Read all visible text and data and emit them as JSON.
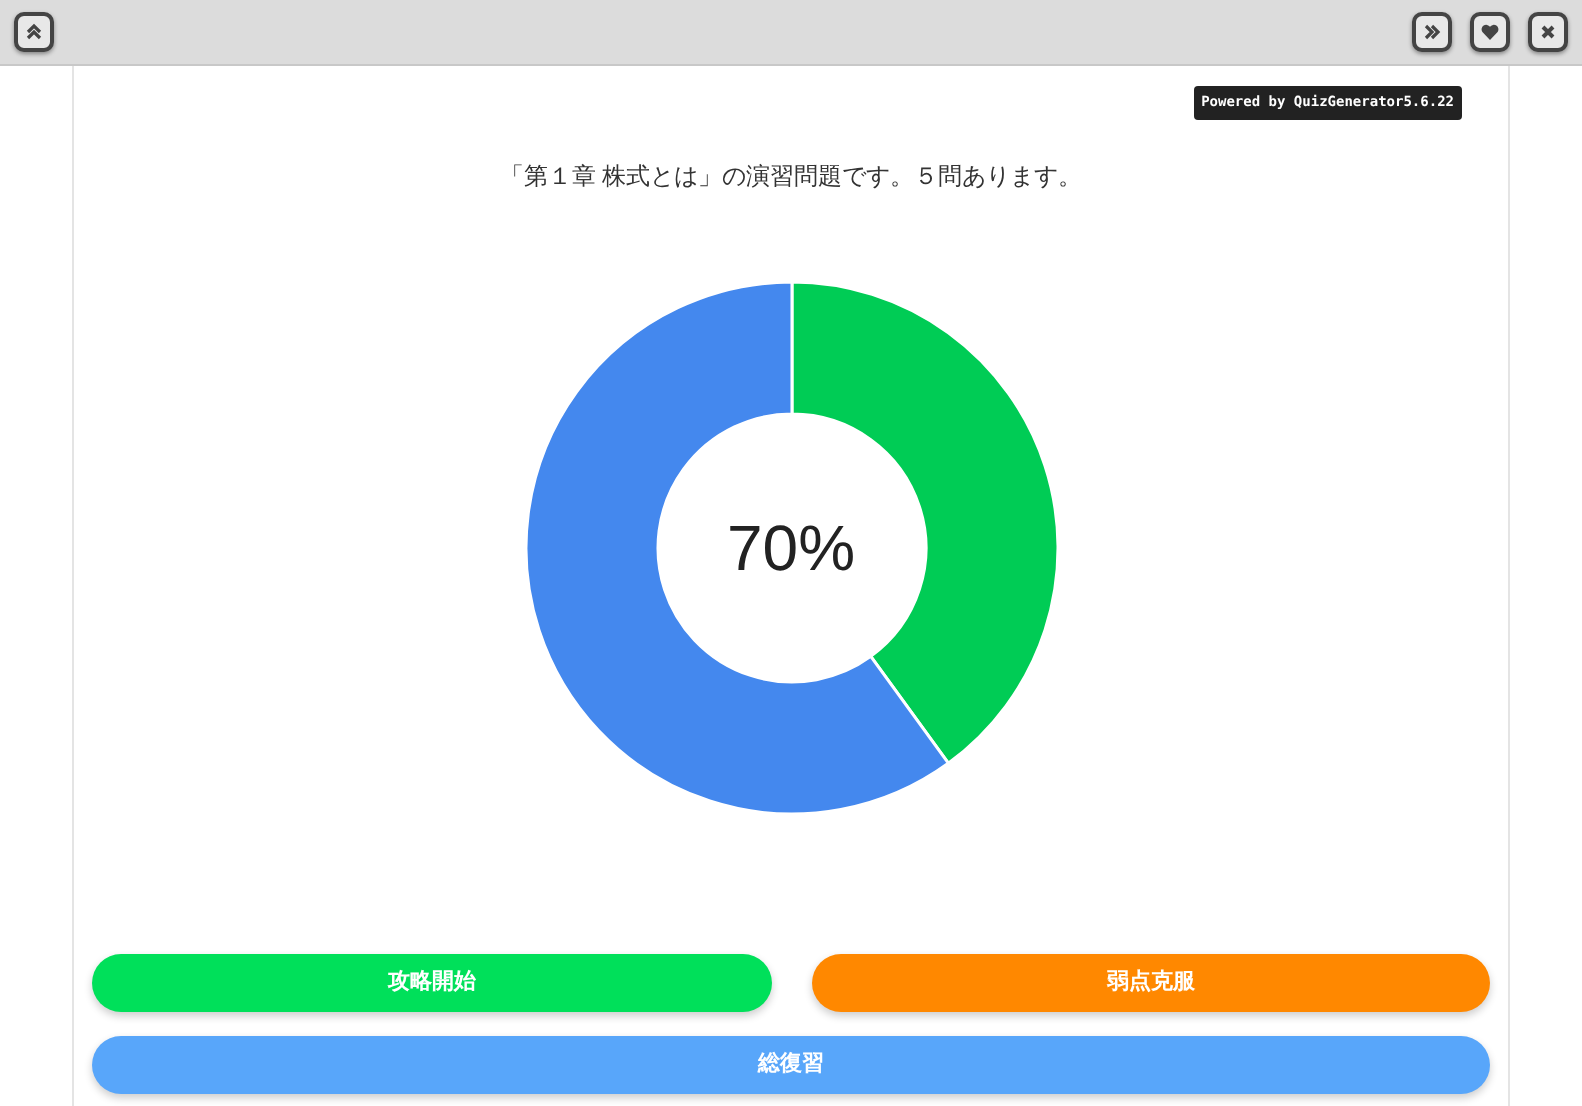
{
  "toolbar": {
    "left_buttons": [
      {
        "kind": "up"
      }
    ],
    "right_buttons": [
      {
        "kind": "forward"
      },
      {
        "kind": "heart"
      },
      {
        "kind": "close"
      }
    ]
  },
  "badge": "Powered by QuizGenerator5.6.22",
  "intro": "「第１章 株式とは」の演習問題です。５問あります。",
  "chart": {
    "center_label": "70%"
  },
  "buttons": [
    {
      "label": "攻略開始",
      "color": "#00e05a"
    },
    {
      "label": "弱点克服",
      "color": "#ff8800"
    },
    {
      "label": "総復習",
      "color": "#58a6fa"
    }
  ]
}
